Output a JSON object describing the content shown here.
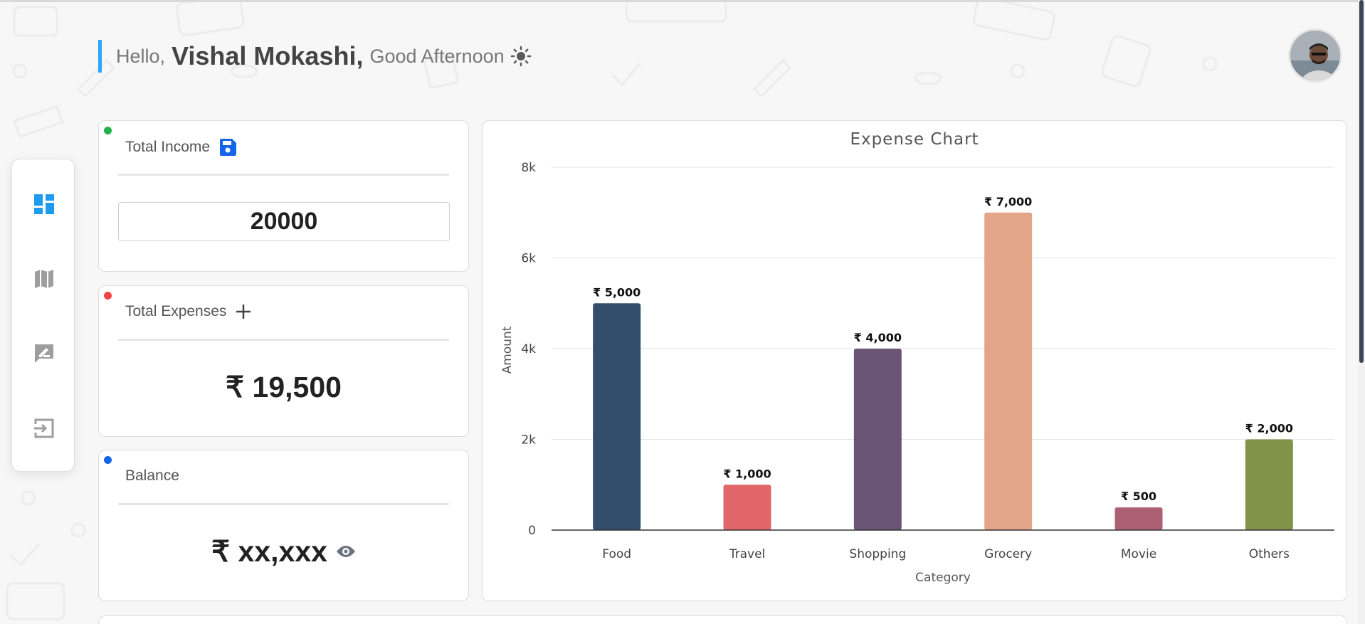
{
  "greeting": {
    "hello": "Hello,",
    "name": "Vishal Mokashi,",
    "time_of_day": "Good Afternoon",
    "icon": "sun-icon"
  },
  "avatar": {
    "icon": "user-avatar"
  },
  "nav": {
    "items": [
      {
        "icon": "dashboard-icon",
        "active": true
      },
      {
        "icon": "map-icon",
        "active": false
      },
      {
        "icon": "feedback-icon",
        "active": false
      },
      {
        "icon": "logout-icon",
        "active": false
      }
    ],
    "active_color": "#1e9bf0",
    "inactive_color": "#9e9e9e"
  },
  "cards": {
    "income": {
      "label": "Total Income",
      "value": "20000",
      "dot_color": "#22b24c",
      "icon": "save-icon"
    },
    "expenses": {
      "label": "Total Expenses",
      "value": "₹ 19,500",
      "dot_color": "#ef4444",
      "icon": "plus-icon"
    },
    "balance": {
      "label": "Balance",
      "value": "₹ xx,xxx",
      "dot_color": "#1565e8",
      "icon": "eye-icon"
    }
  },
  "chart_data": {
    "type": "bar",
    "title": "Expense Chart",
    "xlabel": "Category",
    "ylabel": "Amount",
    "categories": [
      "Food",
      "Travel",
      "Shopping",
      "Grocery",
      "Movie",
      "Others"
    ],
    "values": [
      5000,
      1000,
      4000,
      7000,
      500,
      2000
    ],
    "value_labels": [
      "₹ 5,000",
      "₹ 1,000",
      "₹ 4,000",
      "₹ 7,000",
      "₹ 500",
      "₹ 2,000"
    ],
    "colors": [
      "#334e6b",
      "#e06669",
      "#6a5577",
      "#e3a587",
      "#ad6073",
      "#809349"
    ],
    "yticks": [
      0,
      2000,
      4000,
      6000,
      8000
    ],
    "ytick_labels": [
      "0",
      "2k",
      "4k",
      "6k",
      "8k"
    ],
    "ylim": [
      0,
      8000
    ],
    "grid": true
  }
}
